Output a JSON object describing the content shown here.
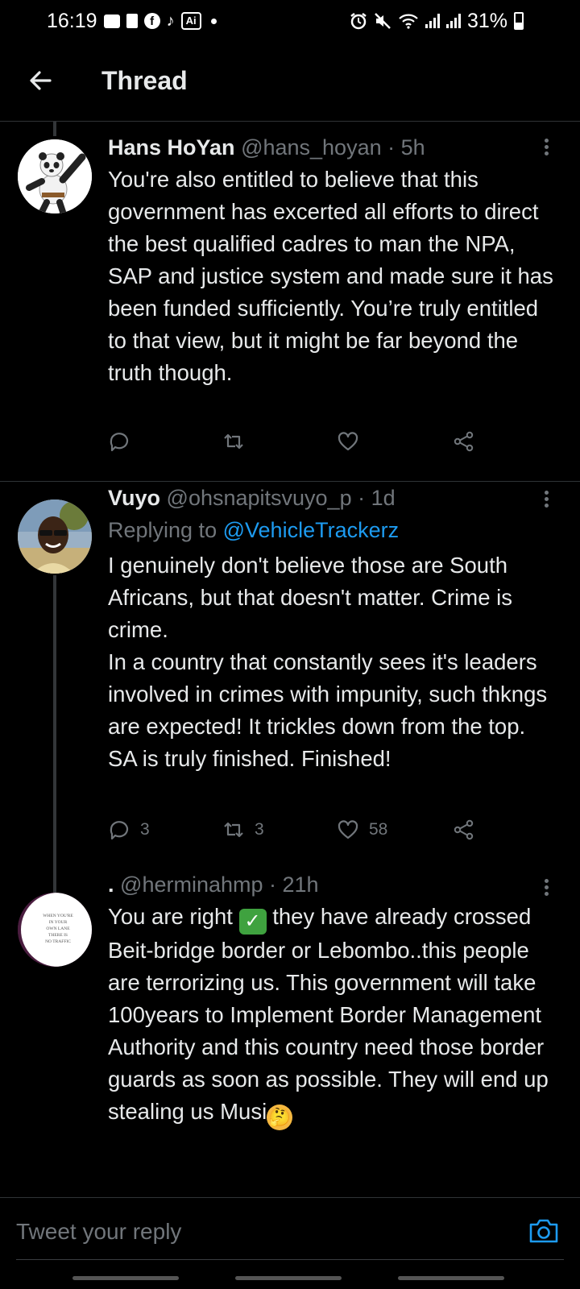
{
  "status_bar": {
    "time": "16:19",
    "tiktok_glyph": "♪",
    "ai_badge": "Ai",
    "battery": "31%",
    "icons": [
      "message-icon",
      "document-icon",
      "facebook-icon",
      "tiktok-icon",
      "ai-icon",
      "alarm-icon",
      "mute-icon",
      "wifi-icon",
      "signal-icon",
      "battery-icon"
    ]
  },
  "header": {
    "title": "Thread",
    "back_icon": "arrow-left-icon"
  },
  "tweets": [
    {
      "name": "Hans HoYan",
      "handle": "@hans_hoyan",
      "time": "· 5h",
      "text": "You're also entitled to believe that this government has excerted all efforts to direct the best qualified cadres to man the NPA, SAP and justice system and made sure it has been funded sufficiently. You’re truly entitled to that view, but it might be far beyond the truth though.",
      "replies": "",
      "retweets": "",
      "likes": ""
    },
    {
      "name": "Vuyo",
      "handle": "@ohsnapitsvuyo_p",
      "time": "· 1d",
      "replying_prefix": "Replying to",
      "replying_to": "@VehicleTrackerz",
      "text": "I genuinely don't believe those are South Africans, but that doesn't matter. Crime is crime.\nIn a country that constantly sees it's leaders involved in crimes with impunity, such thkngs are expected! It trickles down from the top. SA is truly finished. Finished!",
      "replies": "3",
      "retweets": "3",
      "likes": "58"
    },
    {
      "name": ".",
      "handle": "@herminahmp",
      "time": "· 21h",
      "text_a": "You are right ",
      "check_emoji": "✓",
      "text_b": " they have already crossed Beit-bridge border or Lebombo..this people are terrorizing us. This government will take 100years to Implement Border Management Authority and this country need those border guards as soon as possible. They will end up stealing us Musi",
      "think_emoji": "🤔",
      "avatar_text": [
        "WHEN YOU'RE",
        "IN YOUR",
        "OWN LANE",
        "THERE IS",
        "NO TRAFFIC"
      ]
    }
  ],
  "reply_box": {
    "placeholder": "Tweet your reply",
    "camera_icon": "camera-icon"
  },
  "colors": {
    "background": "#000000",
    "text": "#e7e9ea",
    "muted": "#71767b",
    "link": "#1d9bf0",
    "divider": "#2f3336"
  }
}
